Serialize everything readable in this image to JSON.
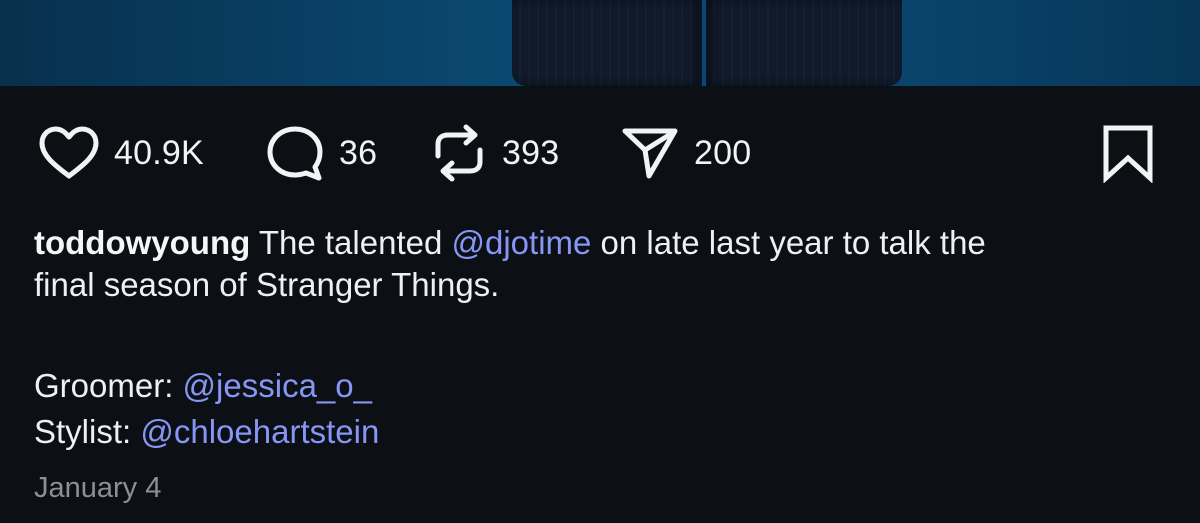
{
  "post": {
    "actions": {
      "likes": "40.9K",
      "comments": "36",
      "reposts": "393",
      "shares": "200"
    },
    "caption": {
      "username": "toddowyoung",
      "text_before": " The talented ",
      "mention": "@djotime",
      "text_after_line1": " on late last year to talk the",
      "line2": "final season of Stranger Things."
    },
    "credits": [
      {
        "label": "Groomer: ",
        "handle": "@jessica_o_"
      },
      {
        "label": "Stylist: ",
        "handle": "@chloehartstein"
      }
    ],
    "date": "January 4"
  },
  "colors": {
    "background": "#0c0f14",
    "mention": "#8696f5",
    "date": "#8a8f98",
    "photo_blue": "#0a4a73"
  },
  "icons": [
    "heart-icon",
    "comment-icon",
    "repost-icon",
    "share-icon",
    "bookmark-icon"
  ]
}
